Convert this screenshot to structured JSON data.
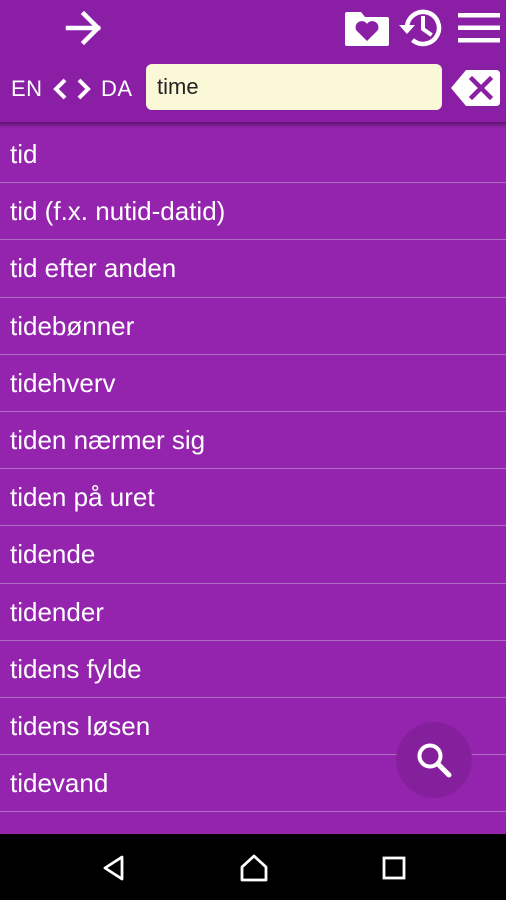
{
  "toolbar": {
    "forward_icon": "arrow-right-icon",
    "favorites_icon": "heart-folder-icon",
    "history_icon": "history-icon",
    "menu_icon": "hamburger-menu-icon"
  },
  "language": {
    "source": "EN",
    "target": "DA",
    "prev_icon": "chevron-left-icon",
    "next_icon": "chevron-right-icon"
  },
  "search": {
    "value": "time",
    "clear_icon": "backspace-clear-icon"
  },
  "results": [
    "tid",
    "tid (f.x. nutid-datid)",
    "tid efter anden",
    "tidebønner",
    "tidehverv",
    "tiden nærmer sig",
    "tiden på uret",
    "tidende",
    "tidender",
    "tidens fylde",
    "tidens løsen",
    "tidevand"
  ],
  "fab": {
    "icon": "search-icon"
  },
  "system_nav": {
    "back_icon": "back-triangle-icon",
    "home_icon": "home-icon",
    "recents_icon": "recents-square-icon"
  },
  "colors": {
    "toolbar": "#8a1fa6",
    "list_background": "#9424ad",
    "divider": "#b06bc5",
    "search_field": "#fbf8d8",
    "fab": "#85209c"
  }
}
